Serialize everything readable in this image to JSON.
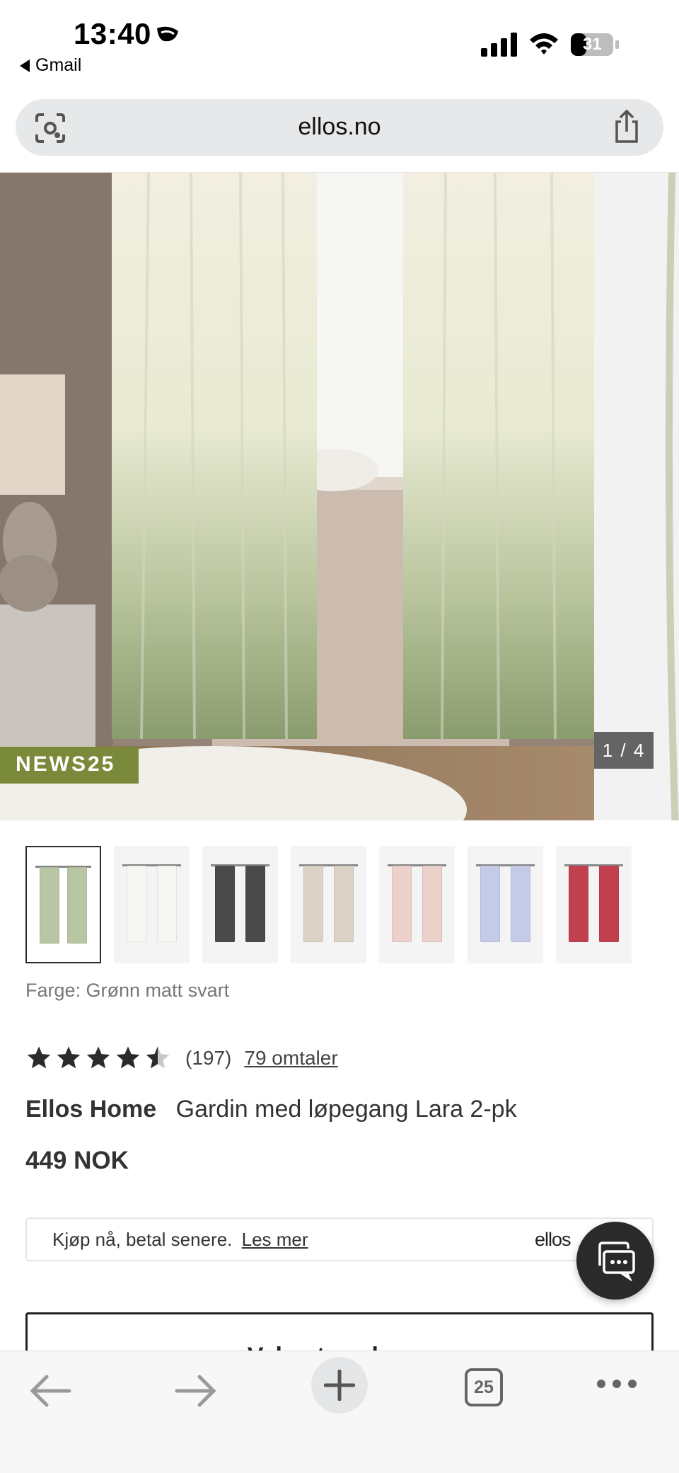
{
  "status_bar": {
    "time": "13:40",
    "back_app": "Gmail",
    "battery": "31"
  },
  "browser": {
    "url": "ellos.no",
    "tab_count": "25"
  },
  "gallery": {
    "badge": "NEWS25",
    "counter": "1 / 4",
    "current_image": 1,
    "total_images": 4
  },
  "color_swatches": [
    {
      "name": "green",
      "color": "#b9c6a4",
      "selected": true
    },
    {
      "name": "white",
      "color": "#f6f6f3",
      "selected": false
    },
    {
      "name": "black",
      "color": "#4a4a4a",
      "selected": false
    },
    {
      "name": "beige",
      "color": "#ddd2c6",
      "selected": false
    },
    {
      "name": "pink",
      "color": "#ecd0ca",
      "selected": false
    },
    {
      "name": "blue",
      "color": "#c3cbe8",
      "selected": false
    },
    {
      "name": "red",
      "color": "#c0404e",
      "selected": false
    }
  ],
  "product": {
    "color_label": "Farge: Grønn matt svart",
    "rating_value": 4.5,
    "rating_count": "(197)",
    "reviews_link": "79 omtaler",
    "brand": "Ellos Home",
    "name": "Gardin med løpegang Lara 2-pk",
    "price": "449 NOK"
  },
  "payment": {
    "text": "Kjøp nå, betal senere.",
    "link": "Les mer",
    "logo": "ellos"
  },
  "size_button": {
    "label": "Velg størrelse"
  },
  "colors": {
    "badge_green": "#7a8a3a",
    "dark": "#2a2a2a",
    "urlbar_bg": "#e6e8ea"
  }
}
